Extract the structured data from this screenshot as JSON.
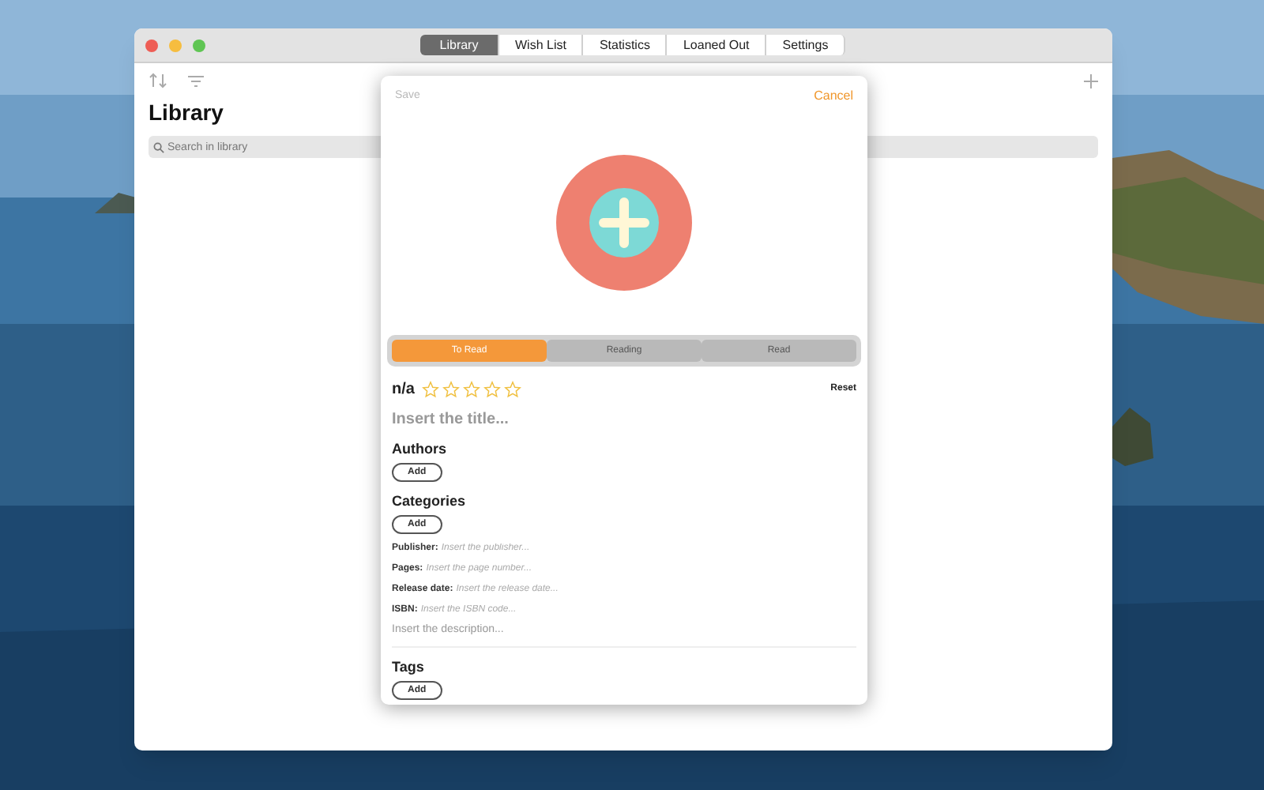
{
  "window": {
    "tabs": [
      {
        "label": "Library",
        "selected": true
      },
      {
        "label": "Wish List",
        "selected": false
      },
      {
        "label": "Statistics",
        "selected": false
      },
      {
        "label": "Loaned Out",
        "selected": false
      },
      {
        "label": "Settings",
        "selected": false
      }
    ]
  },
  "library": {
    "title": "Library",
    "search": {
      "placeholder": "Search in library"
    }
  },
  "editor": {
    "save": {
      "label": "Save",
      "disabled": true
    },
    "cancel": "Cancel",
    "status": [
      {
        "label": "To Read",
        "selected": true
      },
      {
        "label": "Reading",
        "selected": false
      },
      {
        "label": "Read",
        "selected": false
      }
    ],
    "rating": {
      "label": "n/a",
      "stars": 0
    },
    "reset": "Reset",
    "title_placeholder": "Insert the title...",
    "groups": [
      {
        "heading": "Authors",
        "button": "Add"
      },
      {
        "heading": "Categories",
        "button": "Add"
      }
    ],
    "fields": [
      {
        "label": "Publisher:",
        "placeholder": "Insert the publisher..."
      },
      {
        "label": "Pages:",
        "placeholder": "Insert the page number..."
      },
      {
        "label": "Release date:",
        "placeholder": "Insert the release date..."
      },
      {
        "label": "ISBN:",
        "placeholder": "Insert the ISBN code..."
      }
    ],
    "description_placeholder": "Insert the description...",
    "tags": {
      "heading": "Tags",
      "button": "Add"
    }
  }
}
